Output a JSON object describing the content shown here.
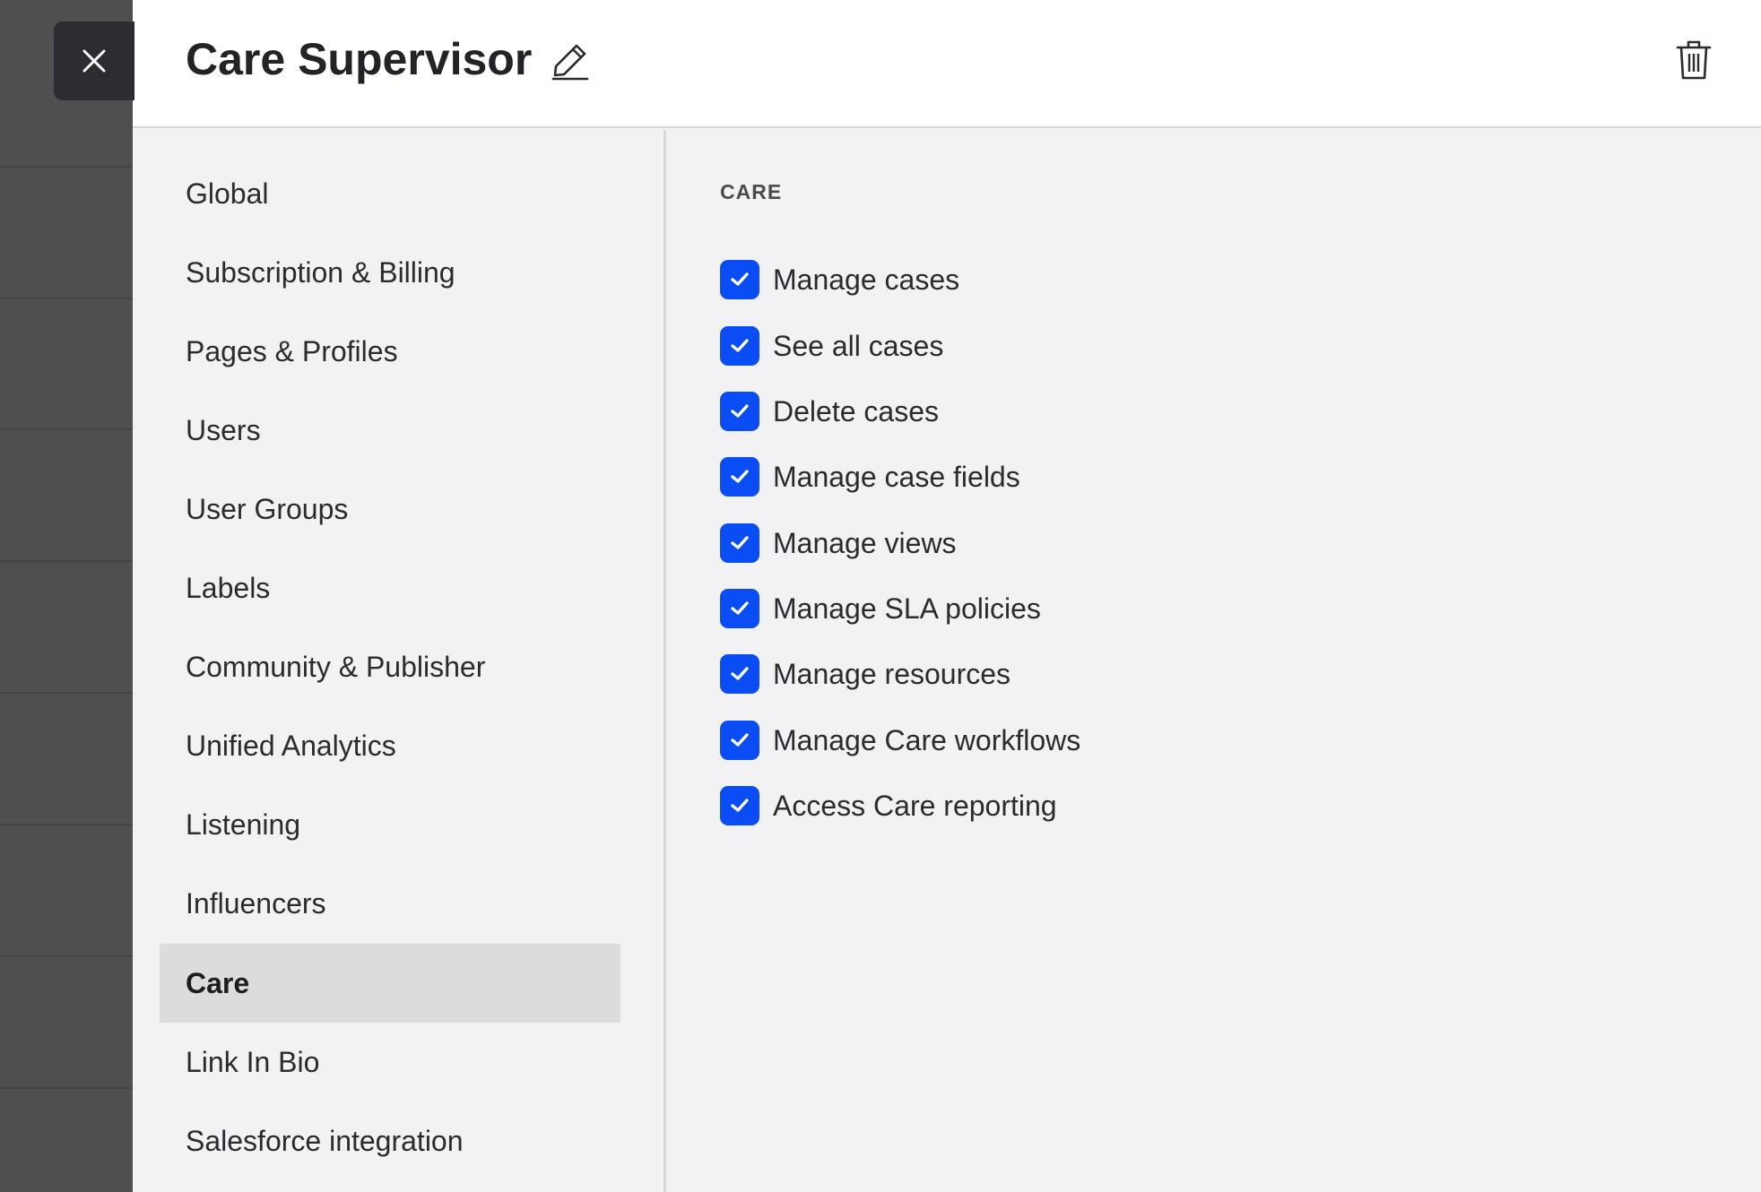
{
  "drawer": {
    "title": "Care Supervisor",
    "close_icon": "close-icon",
    "edit_icon": "pencil-icon",
    "delete_icon": "trash-icon"
  },
  "nav": {
    "items": [
      {
        "label": "Global",
        "active": false
      },
      {
        "label": "Subscription & Billing",
        "active": false
      },
      {
        "label": "Pages & Profiles",
        "active": false
      },
      {
        "label": "Users",
        "active": false
      },
      {
        "label": "User Groups",
        "active": false
      },
      {
        "label": "Labels",
        "active": false
      },
      {
        "label": "Community & Publisher",
        "active": false
      },
      {
        "label": "Unified Analytics",
        "active": false
      },
      {
        "label": "Listening",
        "active": false
      },
      {
        "label": "Influencers",
        "active": false
      },
      {
        "label": "Care",
        "active": true
      },
      {
        "label": "Link In Bio",
        "active": false
      },
      {
        "label": "Salesforce integration",
        "active": false
      }
    ]
  },
  "section": {
    "title": "CARE",
    "permissions": [
      {
        "label": "Manage cases",
        "checked": true
      },
      {
        "label": "See all cases",
        "checked": true
      },
      {
        "label": "Delete cases",
        "checked": true
      },
      {
        "label": "Manage case fields",
        "checked": true
      },
      {
        "label": "Manage views",
        "checked": true
      },
      {
        "label": "Manage SLA policies",
        "checked": true
      },
      {
        "label": "Manage resources",
        "checked": true
      },
      {
        "label": "Manage Care workflows",
        "checked": true
      },
      {
        "label": "Access Care reporting",
        "checked": true
      }
    ]
  },
  "colors": {
    "checkbox": "#0b4df5",
    "active_nav_bg": "#dcdcde",
    "panel_bg": "#f2f2f4"
  }
}
